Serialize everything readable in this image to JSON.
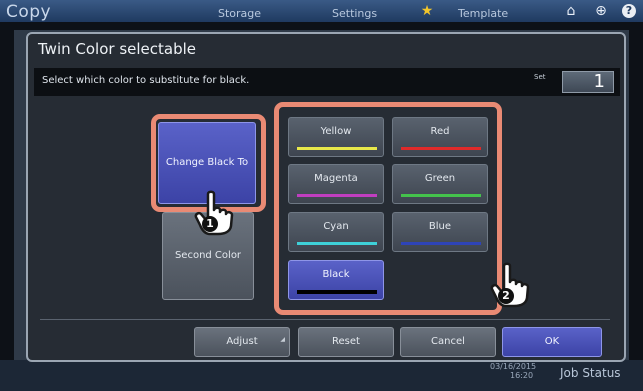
{
  "topbar": {
    "app_title": "Copy",
    "tabs": [
      "Storage",
      "Settings",
      "Template"
    ],
    "icons": [
      "star-icon",
      "home-icon",
      "globe-icon",
      "help-icon"
    ]
  },
  "dialog": {
    "title": "Twin Color selectable",
    "instruction": "Select which color to substitute for black.",
    "set_label": "Set",
    "set_value": "1"
  },
  "left_buttons": {
    "change_black_to": "Change Black To",
    "second_color": "Second Color"
  },
  "colors": [
    {
      "label": "Yellow",
      "color": "#e8e84a"
    },
    {
      "label": "Red",
      "color": "#e02a2a"
    },
    {
      "label": "Magenta",
      "color": "#c03ec0"
    },
    {
      "label": "Green",
      "color": "#44c24c"
    },
    {
      "label": "Cyan",
      "color": "#3ed0d8"
    },
    {
      "label": "Blue",
      "color": "#2e44b8"
    },
    {
      "label": "Black",
      "color": "#000000"
    }
  ],
  "bottom_buttons": {
    "adjust": "Adjust",
    "reset": "Reset",
    "cancel": "Cancel",
    "ok": "OK"
  },
  "callouts": [
    "1",
    "2"
  ],
  "statusbar": {
    "date": "03/16/2015",
    "time": "16:20",
    "job_status": "Job Status"
  },
  "accent_colors": {
    "highlight": "#e98a74",
    "selected": "#4a52b8"
  }
}
